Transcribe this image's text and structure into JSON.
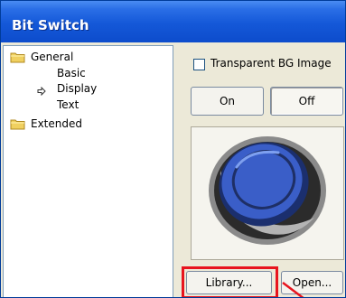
{
  "window": {
    "title": "Bit Switch"
  },
  "tree": {
    "general": "General",
    "basic": "Basic",
    "display": "Display",
    "text": "Text",
    "extended": "Extended"
  },
  "options": {
    "transparent_bg_label": "Transparent BG Image",
    "transparent_bg_checked": false
  },
  "states": {
    "on": "On",
    "off": "Off",
    "selected": "Off"
  },
  "buttons": {
    "library": "Library...",
    "open": "Open..."
  },
  "colors": {
    "highlight": "#e8141e",
    "titlebar": "#0d4ccc"
  },
  "icons": {
    "folder": "folder-icon",
    "selection": "arrow-right-icon"
  }
}
